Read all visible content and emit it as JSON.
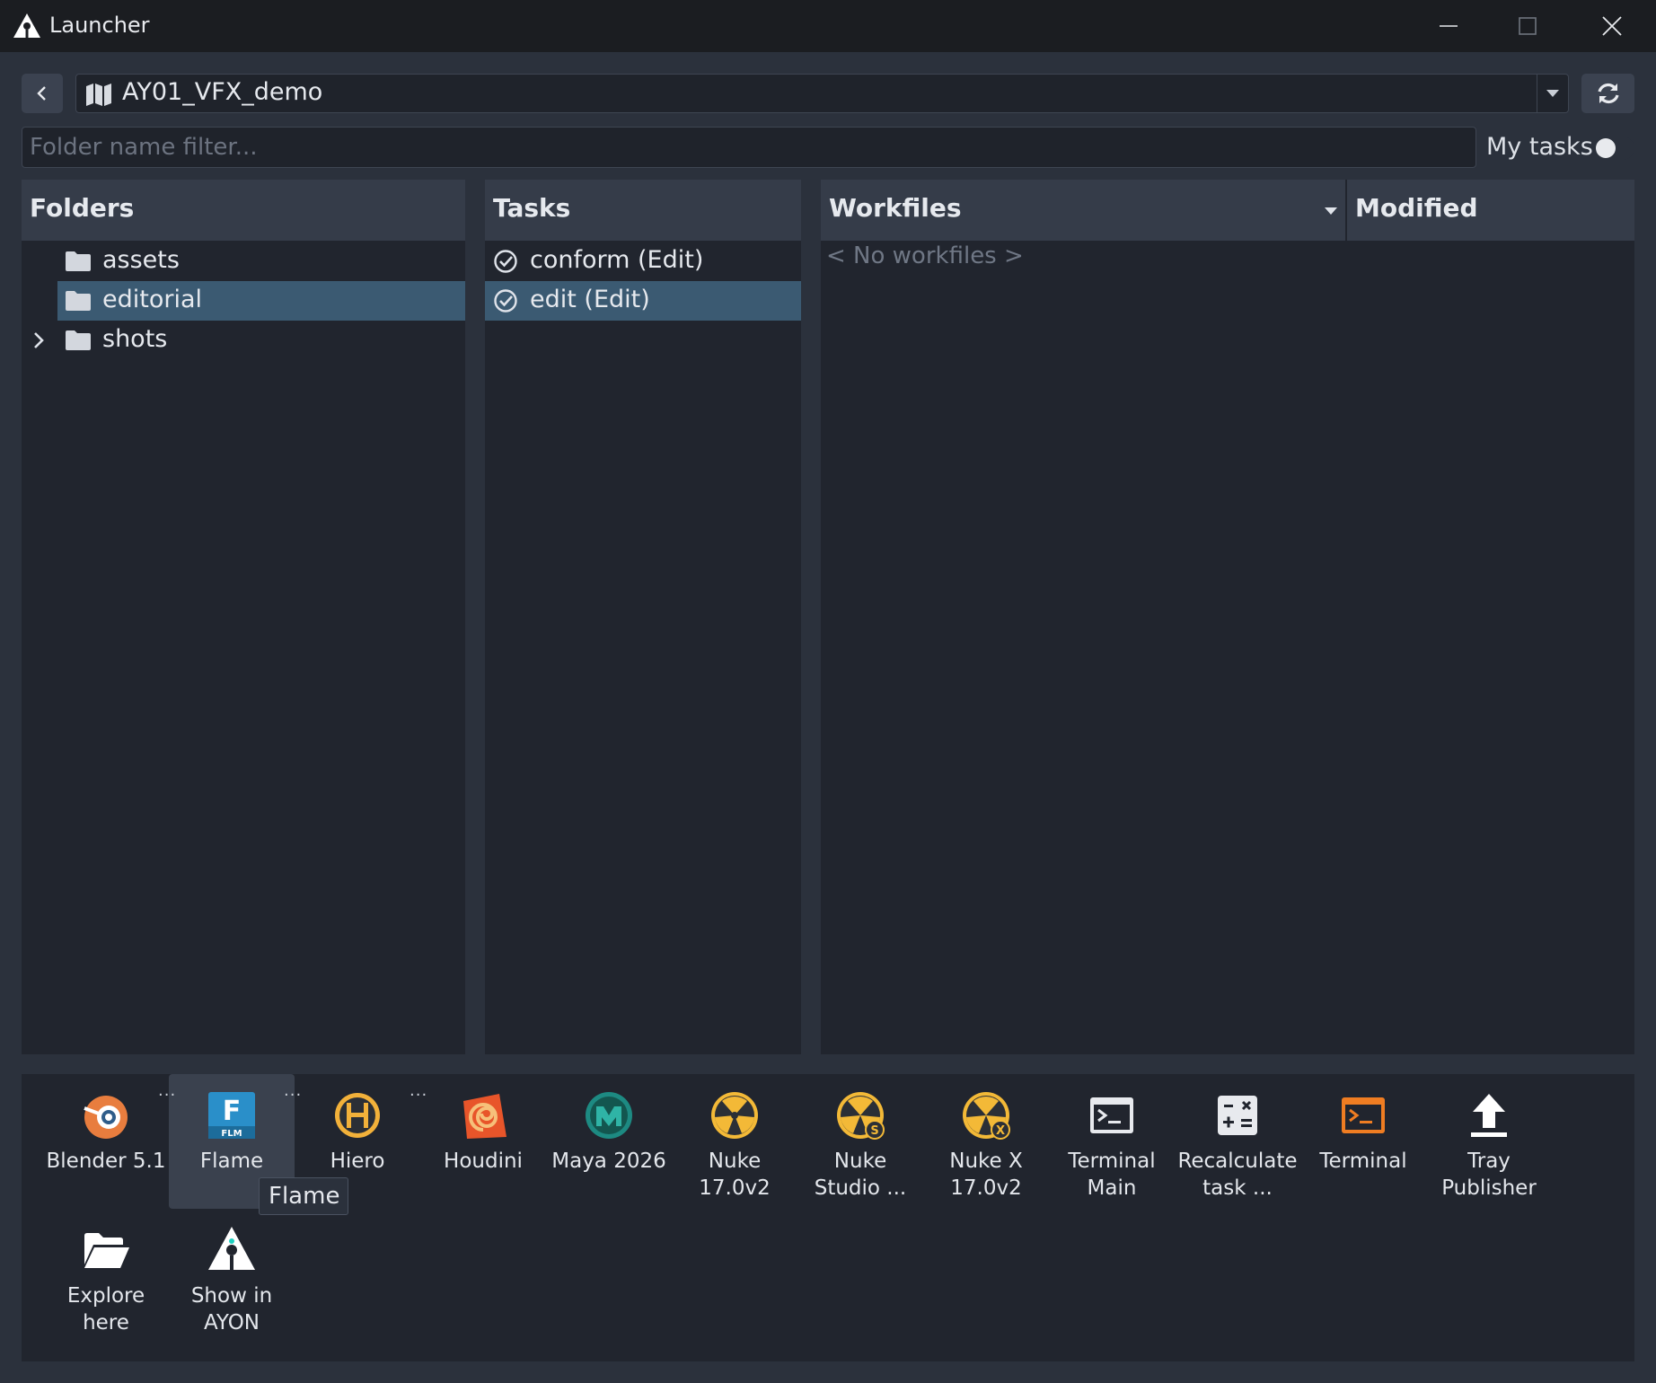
{
  "window": {
    "title": "Launcher",
    "controls": [
      "minimize-icon",
      "maximize-icon",
      "close-icon"
    ]
  },
  "toolbar": {
    "back_icon": "chevron-left-icon",
    "project_icon": "map-icon",
    "project_name": "AY01_VFX_demo",
    "refresh_icon": "refresh-icon"
  },
  "filter": {
    "placeholder": "Folder name filter...",
    "value": "",
    "my_tasks_label": "My tasks",
    "my_tasks_enabled": false
  },
  "folders": {
    "header": "Folders",
    "items": [
      {
        "label": "assets",
        "selected": false,
        "expandable": false
      },
      {
        "label": "editorial",
        "selected": true,
        "expandable": false
      },
      {
        "label": "shots",
        "selected": false,
        "expandable": true
      }
    ]
  },
  "tasks": {
    "header": "Tasks",
    "items": [
      {
        "label": "conform (Edit)",
        "selected": false
      },
      {
        "label": "edit (Edit)",
        "selected": true
      }
    ]
  },
  "workfiles": {
    "header": "Workfiles",
    "modified_header": "Modified",
    "empty_text": "< No workfiles >"
  },
  "apps": [
    {
      "label": "Blender 5.1",
      "icon": "blender-icon"
    },
    {
      "label": "Flame",
      "icon": "flame-icon",
      "icon_text": "F",
      "icon_subtext": "FLM",
      "has_variants": true,
      "hovered": true
    },
    {
      "label": "Hiero",
      "icon": "hiero-icon",
      "has_variants": true
    },
    {
      "label": "Houdini",
      "icon": "houdini-icon",
      "has_variants": true
    },
    {
      "label": "Maya 2026",
      "icon": "maya-icon"
    },
    {
      "label": "Nuke\n17.0v2",
      "icon": "nuke-icon"
    },
    {
      "label": "Nuke\nStudio ...",
      "icon": "nuke-studio-icon",
      "badge": "S"
    },
    {
      "label": "Nuke X\n17.0v2",
      "icon": "nuke-x-icon",
      "badge": "X"
    },
    {
      "label": "Terminal\nMain",
      "icon": "terminal-icon"
    },
    {
      "label": "Recalculate\ntask ...",
      "icon": "calculator-icon"
    },
    {
      "label": "Terminal",
      "icon": "terminal-orange-icon"
    },
    {
      "label": "Tray\nPublisher",
      "icon": "upload-icon"
    },
    {
      "label": "Explore\nhere",
      "icon": "folder-open-icon"
    },
    {
      "label": "Show in\nAYON",
      "icon": "ayon-icon"
    }
  ],
  "more_indicator": "...",
  "tooltip": "Flame",
  "colors": {
    "window_bg": "#2b313c",
    "panel_bg": "#21252e",
    "header_bg": "#353c49",
    "selection": "#3b5a72",
    "titlebar": "#1b1d21"
  }
}
